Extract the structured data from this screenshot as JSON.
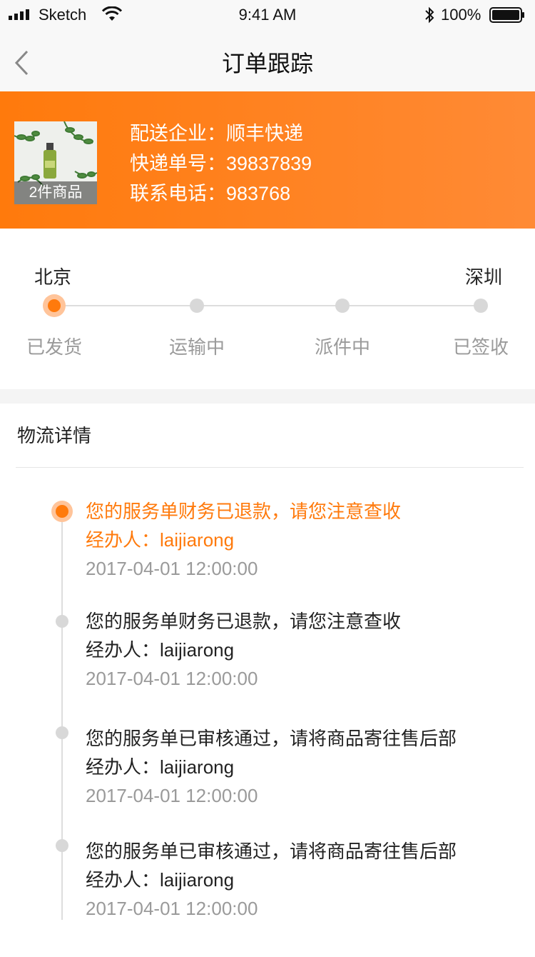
{
  "status_bar": {
    "carrier": "Sketch",
    "time": "9:41 AM",
    "battery": "100%",
    "icons": [
      "signal-icon",
      "wifi-icon",
      "bluetooth-icon",
      "battery-icon"
    ]
  },
  "nav": {
    "title": "订单跟踪",
    "back_icon": "chevron-left-icon"
  },
  "shipment": {
    "item_count": "2件商品",
    "courier_label": "配送企业：",
    "courier": "顺丰快递",
    "tracking_label": "快递单号：",
    "tracking_no": "39837839",
    "phone_label": "联系电话：",
    "phone": "983768"
  },
  "progress": {
    "from_city": "北京",
    "to_city": "深圳",
    "stages": [
      "已发货",
      "运输中",
      "派件中",
      "已签收"
    ],
    "current_stage": 0
  },
  "details": {
    "title": "物流详情",
    "events": [
      {
        "message": "您的服务单财务已退款，请您注意查收",
        "handler_label": "经办人：",
        "handler": "laijiarong",
        "time": "2017-04-01 12:00:00",
        "current": true
      },
      {
        "message": "您的服务单财务已退款，请您注意查收",
        "handler_label": "经办人：",
        "handler": "laijiarong",
        "time": "2017-04-01 12:00:00",
        "current": false
      },
      {
        "message": "您的服务单已审核通过，请将商品寄往售后部",
        "handler_label": "经办人：",
        "handler": "laijiarong",
        "time": "2017-04-01 12:00:00",
        "current": false
      },
      {
        "message": "您的服务单已审核通过，请将商品寄往售后部",
        "handler_label": "经办人：",
        "handler": "laijiarong",
        "time": "2017-04-01 12:00:00",
        "current": false
      }
    ]
  },
  "colors": {
    "accent": "#ff7a0c",
    "inactive": "#d8d8d8",
    "muted_text": "#9a9a9a"
  }
}
